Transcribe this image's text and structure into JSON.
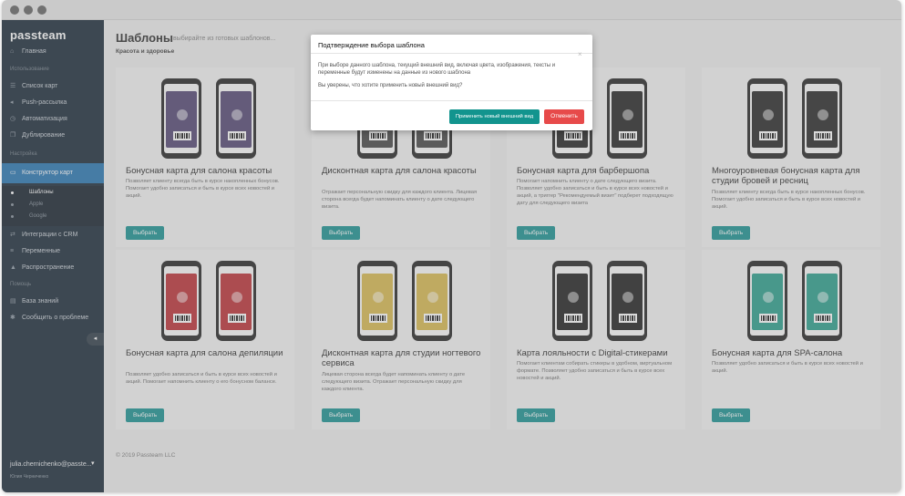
{
  "app": {
    "brand": "passteam"
  },
  "sidebar": {
    "items_top": [
      {
        "icon": "home-icon",
        "glyph": "⌂",
        "label": "Главная"
      }
    ],
    "section_usage": "Использование",
    "items_usage": [
      {
        "icon": "list-icon",
        "glyph": "☰",
        "label": "Список карт"
      },
      {
        "icon": "megaphone-icon",
        "glyph": "◂",
        "label": "Push-рассылка"
      },
      {
        "icon": "clock-icon",
        "glyph": "◷",
        "label": "Автоматизация"
      },
      {
        "icon": "copy-icon",
        "glyph": "❐",
        "label": "Дублирование"
      }
    ],
    "section_settings": "Настройка",
    "active_item": {
      "icon": "card-icon",
      "glyph": "▭",
      "label": "Конструктор карт"
    },
    "subitems": [
      {
        "label": "Шаблоны",
        "active": true
      },
      {
        "label": "Apple",
        "active": false
      },
      {
        "label": "Google",
        "active": false
      }
    ],
    "items_settings": [
      {
        "icon": "integration-icon",
        "glyph": "⇄",
        "label": "Интеграции с CRM"
      },
      {
        "icon": "variables-icon",
        "glyph": "≡",
        "label": "Переменные"
      },
      {
        "icon": "distribution-icon",
        "glyph": "▲",
        "label": "Распространение"
      }
    ],
    "section_help": "Помощь",
    "items_help": [
      {
        "icon": "book-icon",
        "glyph": "▤",
        "label": "База знаний"
      },
      {
        "icon": "bug-icon",
        "glyph": "✱",
        "label": "Сообщить о проблеме"
      }
    ],
    "collapse_glyph": "◂",
    "user_email": "julia.chernichenko@passte...",
    "user_name": "Юлия Черниченко",
    "user_chevron": "▾"
  },
  "header": {
    "title": "Шаблоны",
    "subtitle": "выбирайте из готовых шаблонов...",
    "category": "Красота и здоровье"
  },
  "cards": [
    {
      "title": "Бонусная карта для салона красоты",
      "desc": "Позволяет клиенту всегда быть в курсе накопленных бонусов. Помогает удобно записаться и быть в курсе всех новостей и акций.",
      "button": "Выбрать",
      "pass_color": "#4a3c6c"
    },
    {
      "title": "Дисконтная карта для салона красоты",
      "desc": "Отражает персональную скидку для каждого клиента. Лицевая сторона всегда будет напоминать клиенту о дате следующего визита.",
      "button": "Выбрать",
      "pass_color": "#3c3c3c"
    },
    {
      "title": "Бонусная карта для барбершопа",
      "desc": "Помогает напомнить клиенту о дате следующего визита. Позволяет удобно записаться и быть в курсе всех новостей и акций, а триггер \"Рекомендуемый визит\" подберет подходящую дату для следующего визита",
      "button": "Выбрать",
      "pass_color": "#1a1a1a"
    },
    {
      "title": "Многоуровневая бонусная карта для студии бровей и ресниц",
      "desc": "Позволяет клиенту всегда быть в курсе накопленных бонусов. Помогает удобно записаться и быть в курсе всех новостей и акций.",
      "button": "Выбрать",
      "pass_color": "#1c1c1c"
    },
    {
      "title": "Бонусная карта для салона депиляции",
      "desc": "Позволяет удобно записаться и быть в курсе всех новостей и акций. Помогает напомнить клиенту о его бонусном балансе.",
      "button": "Выбрать",
      "pass_color": "#b8262c"
    },
    {
      "title": "Дисконтная карта для студии ногтевого сервиса",
      "desc": "Лицевая сторона всегда будет напоминать клиенту о дате следующего визита. Отражает персональную скидку для каждого клиента.",
      "button": "Выбрать",
      "pass_color": "#d6b646"
    },
    {
      "title": "Карта лояльности с Digital-стикерами",
      "desc": "Помогает клиентам собирать стикеры в удобном, виртуальном формате. Позволяет удобно записаться и быть в курсе всех новостей и акций.",
      "button": "Выбрать",
      "pass_color": "#151515"
    },
    {
      "title": "Бонусная карта для SPA-салона",
      "desc": "Позволяет удобно записаться и быть в курсе всех новостей и акций.",
      "button": "Выбрать",
      "pass_color": "#1f9a86"
    }
  ],
  "footer": "© 2019 Passteam LLC",
  "modal": {
    "title": "Подтверждение выбора шаблона",
    "close": "×",
    "text1": "При выборе данного шаблона, текущий внешний вид, включая цвета, изображения, тексты и переменные будут изменены на данные из нового шаблона",
    "text2": "Вы уверены, что хотите применить новый внешний вид?",
    "apply_button": "Применить новый внешний вид",
    "cancel_button": "Отменить"
  },
  "colors": {
    "accent": "#12948e",
    "danger": "#e74a4a",
    "sidebar_bg": "#0f1f2e",
    "active_nav": "#1d6fae",
    "arrow": "#3a8fd6"
  }
}
